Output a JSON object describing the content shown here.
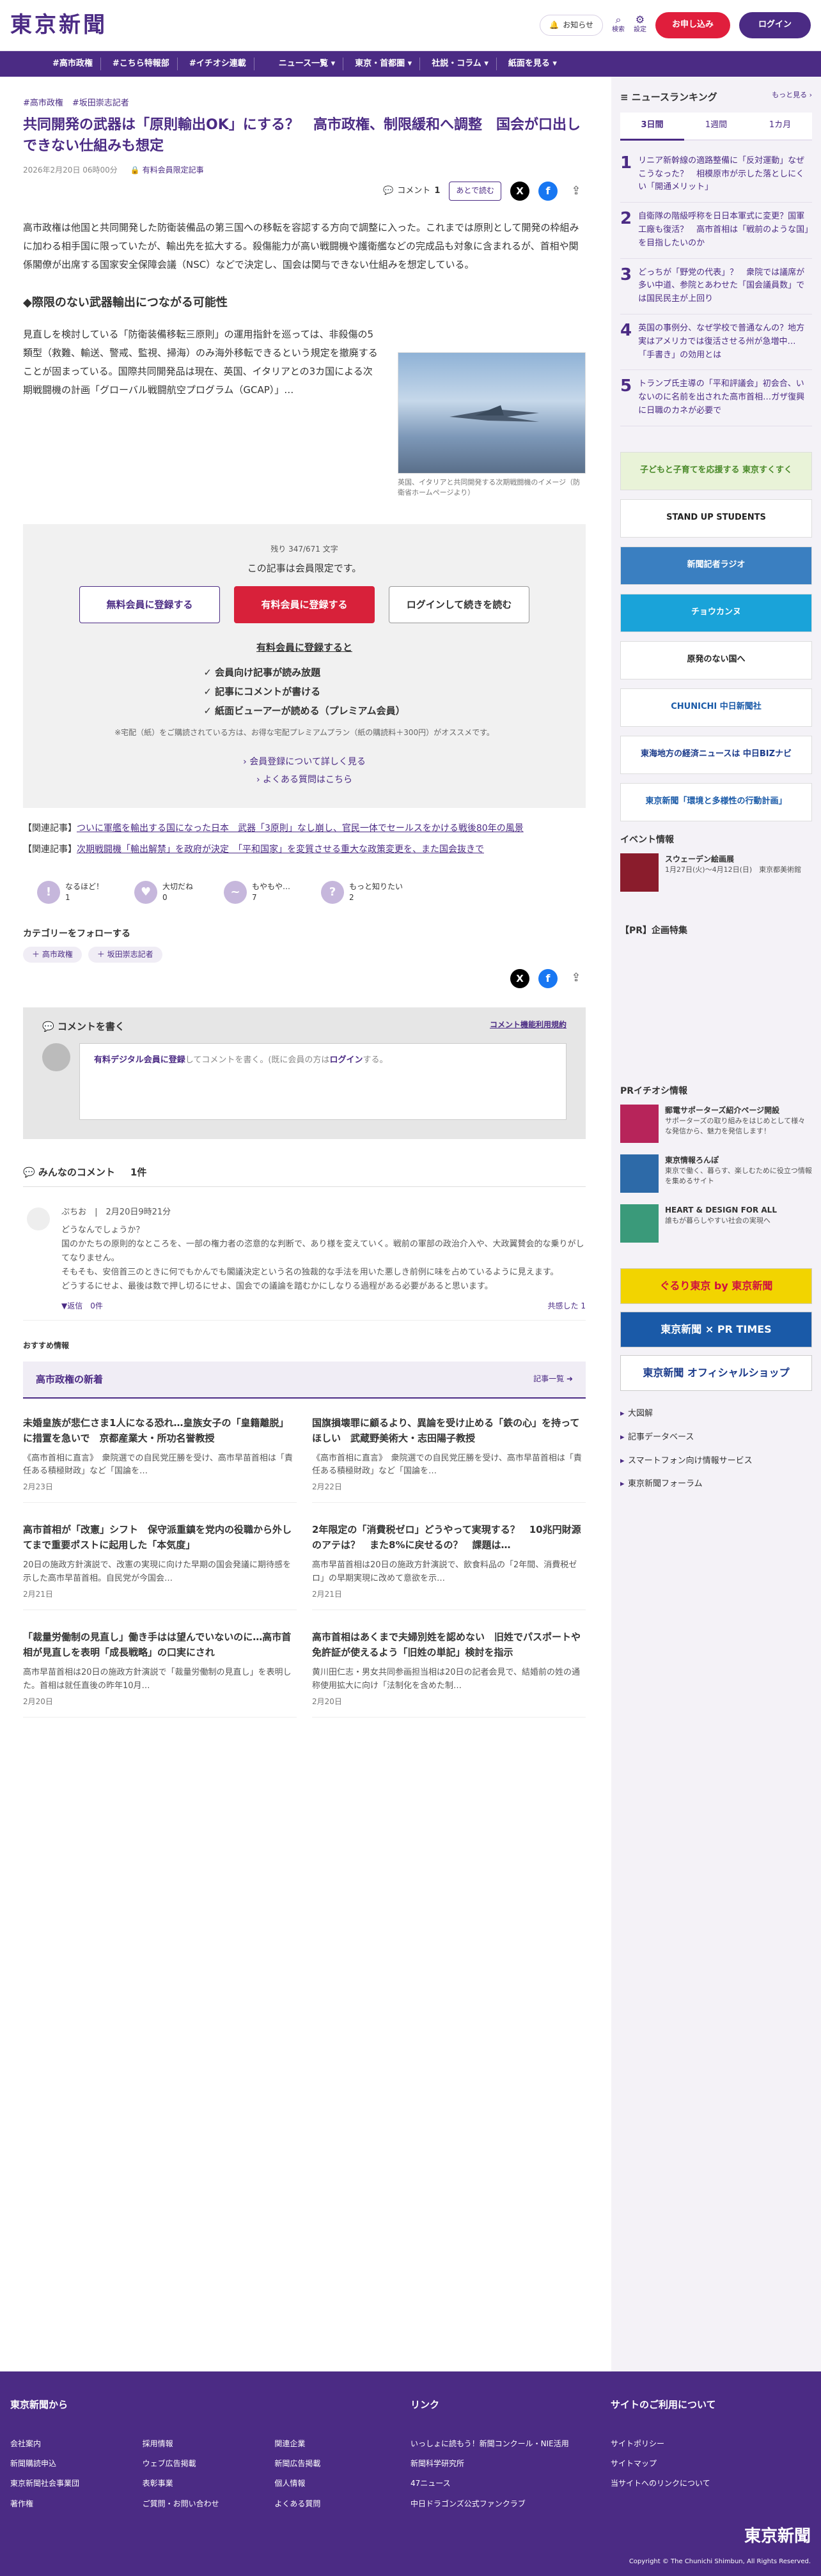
{
  "header": {
    "logo": "東京新聞",
    "notify": "お知らせ",
    "search": "検索",
    "settings": "設定",
    "subscribe": "お申し込み",
    "login": "ログイン"
  },
  "nav": [
    "#高市政権",
    "#こちら特報部",
    "#イチオシ連載",
    "ニュース一覧 ▾",
    "東京・首都圏 ▾",
    "社説・コラム ▾",
    "紙面を見る ▾"
  ],
  "article": {
    "tags": [
      "#高市政権",
      "#坂田崇志記者"
    ],
    "title": "共同開発の武器は「原則輸出OK」にする？　高市政権、制限緩和へ調整　国会が口出しできない仕組みも想定",
    "date": "2026年2月20日 06時00分",
    "member": "有料会員限定記事",
    "comment_label": "コメント",
    "comment_count": "1",
    "later": "あとで読む",
    "lead": "高市政権は他国と共同開発した防衛装備品の第三国への移転を容認する方向で調整に入った。これまでは原則として開発の枠組みに加わる相手国に限っていたが、輸出先を拡大する。殺傷能力が高い戦闘機や護衛艦などの完成品も対象に含まれるが、首相や関係閣僚が出席する国家安全保障会議（NSC）などで決定し、国会は関与できない仕組みを想定している。",
    "h2": "◆際限のない武器輸出につながる可能性",
    "p2": "見直しを検討している「防衛装備移転三原則」の運用指針を巡っては、非殺傷の5類型（救難、輸送、警戒、監視、掃海）のみ海外移転できるという規定を撤廃することが固まっている。国際共同開発品は現在、英国、イタリアとの3カ国による次期戦闘機の計画「グローバル戦闘航空プログラム（GCAP）」…",
    "caption": "英国、イタリアと共同開発する次期戦闘機のイメージ（防衛省ホームページより）"
  },
  "paywall": {
    "remain": "残り 347/671 文字",
    "only": "この記事は会員限定です。",
    "free": "無料会員に登録する",
    "paid": "有料会員に登録する",
    "login": "ログインして続きを読む",
    "benefit_h": "有料会員に登録すると",
    "benefits": [
      "会員向け記事が読み放題",
      "記事にコメントが書ける",
      "紙面ビューアーが読める（プレミアム会員）"
    ],
    "note": "※宅配（紙）をご購読されている方は、お得な宅配プレミアムプラン（紙の購読料＋300円）がオススメです。",
    "link1": "会員登録について詳しく見る",
    "link2": "よくある質問はこちら"
  },
  "related": [
    {
      "label": "【関連記事】",
      "text": "ついに軍艦を輸出する国になった日本　武器「3原則」なし崩し、官民一体でセールスをかける戦後80年の風景"
    },
    {
      "label": "【関連記事】",
      "text": "次期戦闘機「輸出解禁」を政府が決定　「平和国家」を変質させる重大な政策変更を、また国会抜きで"
    }
  ],
  "reactions": [
    {
      "label": "なるほど！",
      "count": "1",
      "icon": "!"
    },
    {
      "label": "大切だね",
      "count": "0",
      "icon": "♥"
    },
    {
      "label": "もやもや…",
      "count": "7",
      "icon": "~"
    },
    {
      "label": "もっと知りたい",
      "count": "2",
      "icon": "?"
    }
  ],
  "follow": {
    "title": "カテゴリーをフォローする",
    "tags": [
      "＋ 高市政権",
      "＋ 坂田崇志記者"
    ]
  },
  "comment_box": {
    "title": "コメントを書く",
    "rules": "コメント機能利用規約",
    "placeholder_link": "有料デジタル会員に登録",
    "placeholder_rest": "してコメントを書く。(既に会員の方は",
    "login": "ログイン",
    "end": "する。"
  },
  "comments": {
    "title": "みんなのコメント",
    "count": "1件",
    "items": [
      {
        "user": "ぷちお",
        "date": "2月20日9時21分",
        "text": "どうなんでしょうか？\n国のかたちの原則的なところを、一部の権力者の恣意的な判断で、あり様を変えていく。戦前の軍部の政治介入や、大政翼賛会的な乗りがしてなりません。\nそもそも、安倍首三のときに何でもかんでも閣議決定という名の独裁的な手法を用いた悪しき前例に味を占めているように見えます。\nどうするにせよ、最後は数で押し切るにせよ、国会での議論を踏むかにしなりる過程がある必要があると思います。",
        "replies": "▼返信　0件",
        "support": "共感した 1"
      }
    ]
  },
  "recommend": {
    "label": "おすすめ情報",
    "series": "高市政権の新着",
    "more": "記事一覧 ➜",
    "items": [
      {
        "title": "未婚皇族が悲仁さま1人になる恐れ…皇族女子の「皇籍離脱」に措置を急いで　京都産業大・所功名誉教授",
        "body": "《高市首相に直言》　衆院選での自民党圧勝を受け、高市早苗首相は「責任ある積極財政」など「国論を…",
        "date": "2月23日"
      },
      {
        "title": "国旗損壊罪に顧るより、異論を受け止める「鉄の心」を持ってほしい　武蔵野美術大・志田陽子教授",
        "body": "《高市首相に直言》　衆院選での自民党圧勝を受け、高市早苗首相は「責任ある積極財政」など「国論を…",
        "date": "2月22日"
      },
      {
        "title": "高市首相が「改憲」シフト　保守派重鎮を党内の役職から外してまで重要ポストに起用した「本気度」",
        "body": "20日の施政方針演説で、改憲の実現に向けた早期の国会発議に期待感を示した高市早苗首相。自民党が今国会…",
        "date": "2月21日"
      },
      {
        "title": "2年限定の「消費税ゼロ」どうやって実現する？　10兆円財源のアテは？　また8%に戻せるの？　課題は…",
        "body": "高市早苗首相は20日の施政方針演説で、飲食料品の「2年間、消費税ゼロ」の早期実現に改めて意欲を示…",
        "date": "2月21日"
      },
      {
        "title": "「裁量労働制の見直し」働き手はは望んでいないのに…高市首相が見直しを表明「成長戦略」の口実にされ",
        "body": "高市早苗首相は20日の施政方針演説で「裁量労働制の見直し」を表明した。首相は就任直後の昨年10月…",
        "date": "2月20日"
      },
      {
        "title": "高市首相はあくまで夫婦別姓を認めない　旧姓でパスポートや免許証が使えるよう「旧姓の単記」検討を指示",
        "body": "黄川田仁志・男女共同参画担当相は20日の記者会見で、結婚前の姓の通称使用拡大に向け「法制化を含めた制…",
        "date": "2月20日"
      }
    ]
  },
  "ranking": {
    "title": "ニュースランキング",
    "more": "もっと見る ›",
    "tabs": [
      "3日間",
      "1週間",
      "1カ月"
    ],
    "items": [
      "リニア新幹線の適路整備に「反対運動」なぜこうなった？　相模原市が示した落としにくい「開通メリット」",
      "自衛隊の階級呼称を日日本軍式に変更？国軍工廠も復活？　高市首相は「戦前のような国」を目指したいのか",
      "どっちが「野党の代表」？　衆院では議席が多い中道、参院とあわせた「国会議員数」では国民民主が上回り",
      "英国の事例分、なぜ学校で普通なんの？地方　実はアメリカでは復活させる州が急増中…「手書き」の効用とは",
      "トランプ氏主導の「平和評議会」初会合、いないのに名前を出された高市首相…ガザ復興に日職のカネが必要で"
    ]
  },
  "banners": [
    "子どもと子育てを応援する 東京すくすく",
    "STAND UP STUDENTS",
    "新聞記者ラジオ",
    "チョウカンヌ",
    "原発のない国へ",
    "CHUNICHI 中日新聞社",
    "東海地方の経済ニュースは 中日BIZナビ",
    "東京新聞「環境と多様性の行動計画」"
  ],
  "events": {
    "title": "イベント情報",
    "item_title": "スウェーデン絵画展",
    "item_desc": "1月27日(火)〜4月12日(日)　東京都美術館"
  },
  "pr": {
    "title": "【PR】企画特集"
  },
  "pr_info": {
    "title": "PRイチオシ情報",
    "items": [
      {
        "title": "郵電サポーターズ紹介ページ開設",
        "desc": "サポーターズの取り組みをはじめとして様々な発信から、魅力を発信します！"
      },
      {
        "title": "東京情報ろんぽ",
        "desc": "東京で働く、暮らす、楽しむために役立つ情報を集めるサイト"
      },
      {
        "title": "HEART & DESIGN FOR ALL",
        "desc": "誰もが暮らしやすい社会の実現へ"
      }
    ]
  },
  "side_banners": [
    "ぐるり東京 by 東京新聞",
    "東京新聞 × PR TIMES",
    "東京新聞 オフィシャルショップ"
  ],
  "side_links": [
    "大図解",
    "記事データベース",
    "スマートフォン向け情報サービス",
    "東京新聞フォーラム"
  ],
  "footer": {
    "col1_title": "東京新聞から",
    "col1": [
      "会社案内",
      "採用情報",
      "関連企業",
      "新聞購読申込",
      "ウェブ広告掲載",
      "新聞広告掲載",
      "東京新聞社会事業団",
      "表彰事業",
      "個人情報",
      "著作権",
      "ご質問・お問い合わせ",
      "よくある質問"
    ],
    "col2_title": "リンク",
    "col2": [
      "いっしょに読もう！新聞コンクール・NIE活用",
      "新聞科学研究所",
      "47ニュース",
      "中日ドラゴンズ公式ファンクラブ"
    ],
    "col3_title": "サイトのご利用について",
    "col3": [
      "サイトポリシー",
      "サイトマップ",
      "当サイトへのリンクについて"
    ],
    "logo": "東京新聞",
    "copy": "Copyright © The Chunichi Shimbun, All Rights Reserved."
  }
}
